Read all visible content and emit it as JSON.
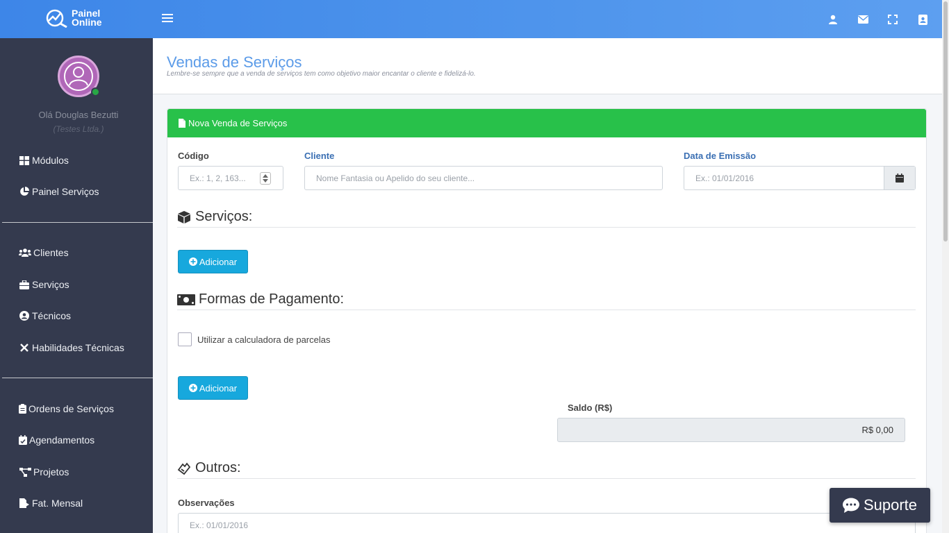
{
  "brand": {
    "line1": "Painel",
    "line2": "Online"
  },
  "topbar_icons": [
    "user-icon",
    "envelope-icon",
    "fullscreen-icon",
    "address-book-icon"
  ],
  "sidebar": {
    "greeting": "Olá Douglas Bezutti",
    "company": "(Testes Ltda.)",
    "items": [
      {
        "label": "Módulos",
        "icon": "grid-icon"
      },
      {
        "label": "Painel Serviços",
        "icon": "pie-chart-icon"
      },
      {
        "label": "Clientes",
        "icon": "users-icon"
      },
      {
        "label": "Serviços",
        "icon": "briefcase-icon"
      },
      {
        "label": "Técnicos",
        "icon": "user-circle-icon"
      },
      {
        "label": "Habilidades Técnicas",
        "icon": "tools-icon"
      },
      {
        "label": "Ordens de Serviços",
        "icon": "clipboard-icon"
      },
      {
        "label": "Agendamentos",
        "icon": "calendar-check-icon"
      },
      {
        "label": "Projetos",
        "icon": "project-diagram-icon"
      },
      {
        "label": "Fat. Mensal",
        "icon": "file-export-icon"
      }
    ]
  },
  "page": {
    "title": "Vendas de Serviços",
    "subtitle": "Lembre-se sempre que a venda de serviços tem como objetivo maior encantar o cliente e fidelizá-lo."
  },
  "form": {
    "card_title": "Nova Venda de Serviços",
    "codigo_label": "Código",
    "codigo_placeholder": "Ex.: 1, 2, 163...",
    "cliente_label": "Cliente",
    "cliente_placeholder": "Nome Fantasia ou Apelido do seu cliente...",
    "data_label": "Data de Emissão",
    "data_placeholder": "Ex.: 01/01/2016",
    "servicos_heading": "Serviços:",
    "add_label": "Adicionar",
    "pagamento_heading": "Formas de Pagamento:",
    "calc_label": "Utilizar a calculadora de parcelas",
    "saldo_label": "Saldo (R$)",
    "saldo_value": "R$ 0,00",
    "outros_heading": "Outros:",
    "obs_label": "Observações",
    "obs_placeholder": "Ex.: 01/01/2016"
  },
  "support_label": "Suporte"
}
